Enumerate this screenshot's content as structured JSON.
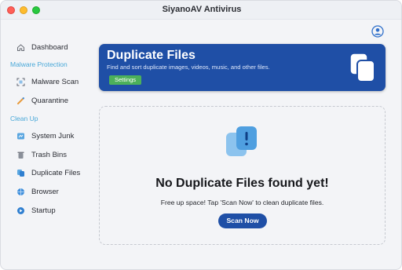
{
  "window": {
    "title": "SiyanoAV Antivirus",
    "controls": [
      "close",
      "minimize",
      "zoom"
    ]
  },
  "sidebar": {
    "dashboard": {
      "label": "Dashboard",
      "icon": "home-icon"
    },
    "sections": [
      {
        "label": "Malware Protection",
        "items": [
          {
            "label": "Malware Scan",
            "icon": "scan-icon"
          },
          {
            "label": "Quarantine",
            "icon": "quarantine-icon"
          }
        ]
      },
      {
        "label": "Clean Up",
        "items": [
          {
            "label": "System Junk",
            "icon": "system-junk-icon"
          },
          {
            "label": "Trash Bins",
            "icon": "trash-icon"
          },
          {
            "label": "Duplicate Files",
            "icon": "duplicate-files-icon"
          },
          {
            "label": "Browser",
            "icon": "browser-icon"
          },
          {
            "label": "Startup",
            "icon": "startup-icon"
          }
        ]
      }
    ]
  },
  "header": {
    "account_icon": "user-avatar-icon"
  },
  "banner": {
    "title": "Duplicate Files",
    "subtitle": "Find and sort duplicate images, videos, music, and other files.",
    "settings_label": "Settings",
    "icon": "duplicate-files-icon"
  },
  "empty_state": {
    "icon": "duplicate-alert-icon",
    "title": "No Duplicate Files found yet!",
    "subtitle": "Free up space! Tap 'Scan Now' to clean duplicate files.",
    "scan_label": "Scan Now"
  },
  "colors": {
    "accent": "#1f4fa6",
    "settings": "#4cb05a",
    "section_label": "#49a8d8",
    "illustration": "#5aa6e0"
  }
}
